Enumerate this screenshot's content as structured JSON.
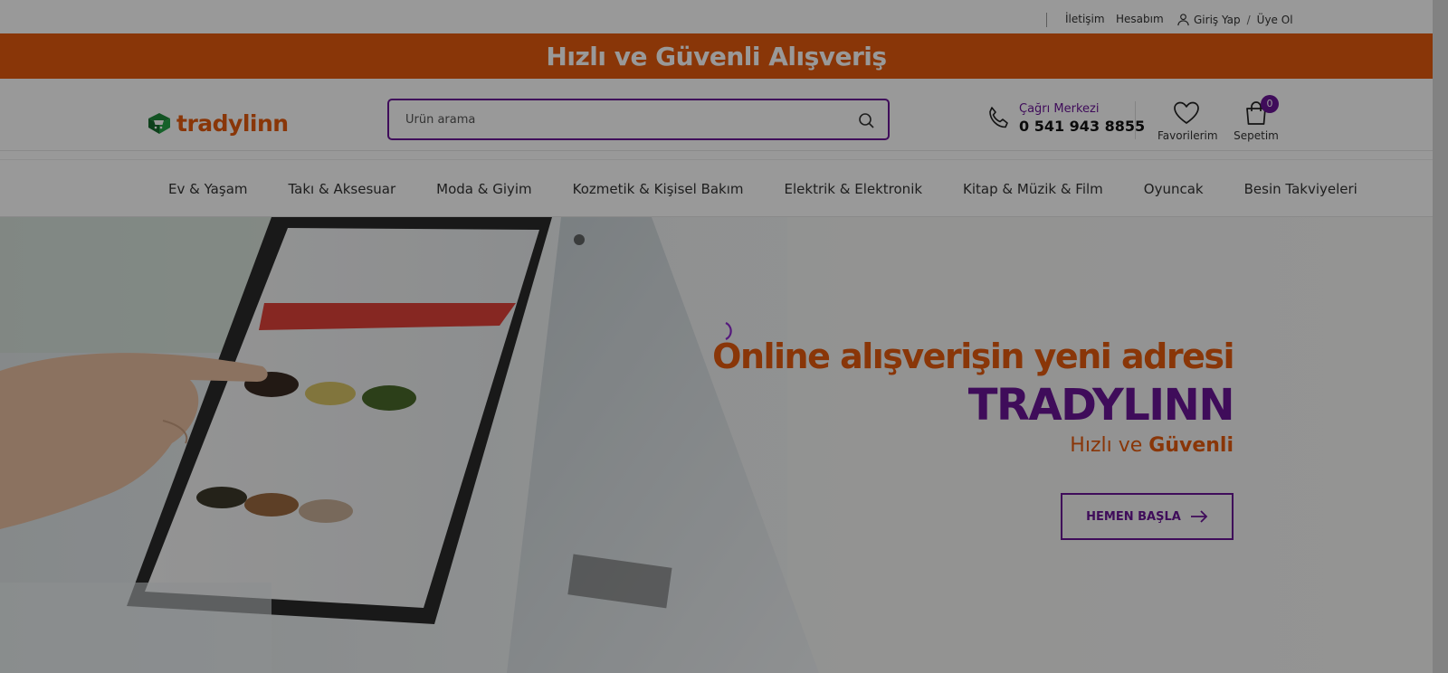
{
  "topbar": {
    "contact": "İletişim",
    "account": "Hesabım",
    "login": "Giriş Yap",
    "slash": "/",
    "register": "Üye Ol"
  },
  "banner": {
    "text": "Hızlı ve Güvenli Alışveriş"
  },
  "header": {
    "logo_text": "tradylinn",
    "search_placeholder": "Ürün arama",
    "call_center_label": "Çağrı Merkezi",
    "call_center_phone": "0 541 943 8855",
    "favorites_label": "Favorilerim",
    "cart_label": "Sepetim",
    "cart_count": "0"
  },
  "nav": {
    "items": [
      "Ev & Yaşam",
      "Takı & Aksesuar",
      "Moda & Giyim",
      "Kozmetik & Kişisel Bakım",
      "Elektrik & Elektronik",
      "Kitap & Müzik & Film",
      "Oyuncak",
      "Besin Takviyeleri"
    ]
  },
  "hero": {
    "line1": "Online alışverişin yeni adresi",
    "line2": "TRADYLINN",
    "line3_a": "Hızlı ve ",
    "line3_b": "Güvenli",
    "button": "HEMEN BAŞLA"
  },
  "colors": {
    "accent_orange": "#e55b0e",
    "accent_purple": "#6a1596"
  }
}
